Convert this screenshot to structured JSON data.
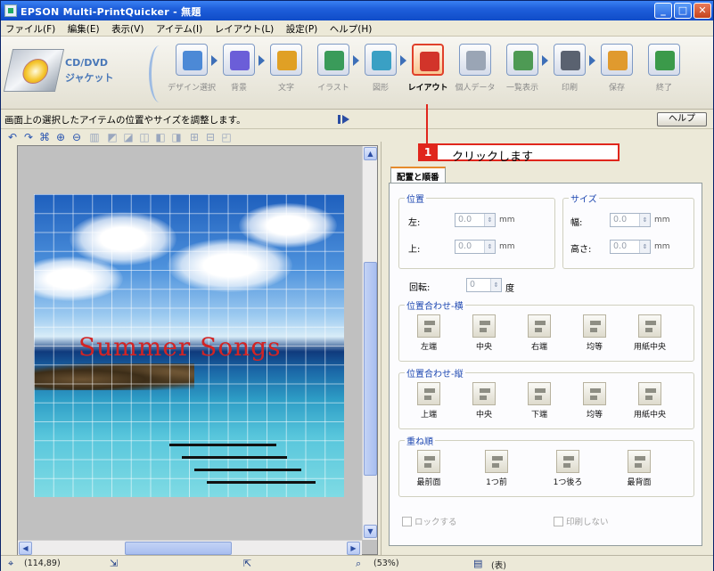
{
  "window": {
    "title": "EPSON Multi-PrintQuicker - 無題",
    "controls": [
      "_",
      "□",
      "✕"
    ]
  },
  "menu": [
    "ファイル(F)",
    "編集(E)",
    "表示(V)",
    "アイテム(I)",
    "レイアウト(L)",
    "設定(P)",
    "ヘルプ(H)"
  ],
  "brand": {
    "line1": "CD/DVD",
    "line2": "ジャケット"
  },
  "tools": [
    {
      "label": "デザイン選択",
      "icon": "design-select-icon",
      "color": "#4c89d6"
    },
    {
      "label": "背景",
      "icon": "background-icon",
      "color": "#6b5ed8"
    },
    {
      "label": "文字",
      "icon": "text-icon",
      "color": "#e0a025"
    },
    {
      "label": "イラスト",
      "icon": "illustration-icon",
      "color": "#3a9b5a"
    },
    {
      "label": "図形",
      "icon": "shape-icon",
      "color": "#3aa0c4"
    },
    {
      "label": "レイアウト",
      "icon": "layout-icon",
      "color": "#d2342a"
    },
    {
      "label": "個人データ",
      "icon": "personal-data-icon",
      "color": "#9aa5b5"
    },
    {
      "label": "一覧表示",
      "icon": "list-view-icon",
      "color": "#4e9a54"
    },
    {
      "label": "印刷",
      "icon": "print-icon",
      "color": "#5a6270"
    },
    {
      "label": "保存",
      "icon": "save-icon",
      "color": "#e09a2e"
    },
    {
      "label": "終了",
      "icon": "exit-icon",
      "color": "#3b9a4a"
    }
  ],
  "active_tool": "レイアウト",
  "hint_text": "画面上の選択したアイテムの位置やサイズを調整します。",
  "help_label": "ヘルプ",
  "callout": {
    "number": "1",
    "text": "クリックします"
  },
  "artwork": {
    "title": "Summer Songs"
  },
  "panel": {
    "tab_label": "配置と順番",
    "position": {
      "title": "位置",
      "left_label": "左:",
      "left_value": "0.0",
      "top_label": "上:",
      "top_value": "0.0",
      "unit": "mm"
    },
    "size": {
      "title": "サイズ",
      "width_label": "幅:",
      "width_value": "0.0",
      "height_label": "高さ:",
      "height_value": "0.0",
      "unit": "mm"
    },
    "rotation": {
      "label": "回転:",
      "value": "0",
      "unit": "度"
    },
    "align_h": {
      "title": "位置合わせ-横",
      "buttons": [
        "左端",
        "中央",
        "右端",
        "均等",
        "用紙中央"
      ]
    },
    "align_v": {
      "title": "位置合わせ-縦",
      "buttons": [
        "上端",
        "中央",
        "下端",
        "均等",
        "用紙中央"
      ]
    },
    "order": {
      "title": "重ね順",
      "buttons": [
        "最前面",
        "1つ前",
        "1つ後ろ",
        "最背面"
      ]
    },
    "lock_label": "ロックする",
    "noprint_label": "印刷しない"
  },
  "status": {
    "coords": "(114,89)",
    "zoom": "(53%)",
    "mode": "(表)"
  }
}
